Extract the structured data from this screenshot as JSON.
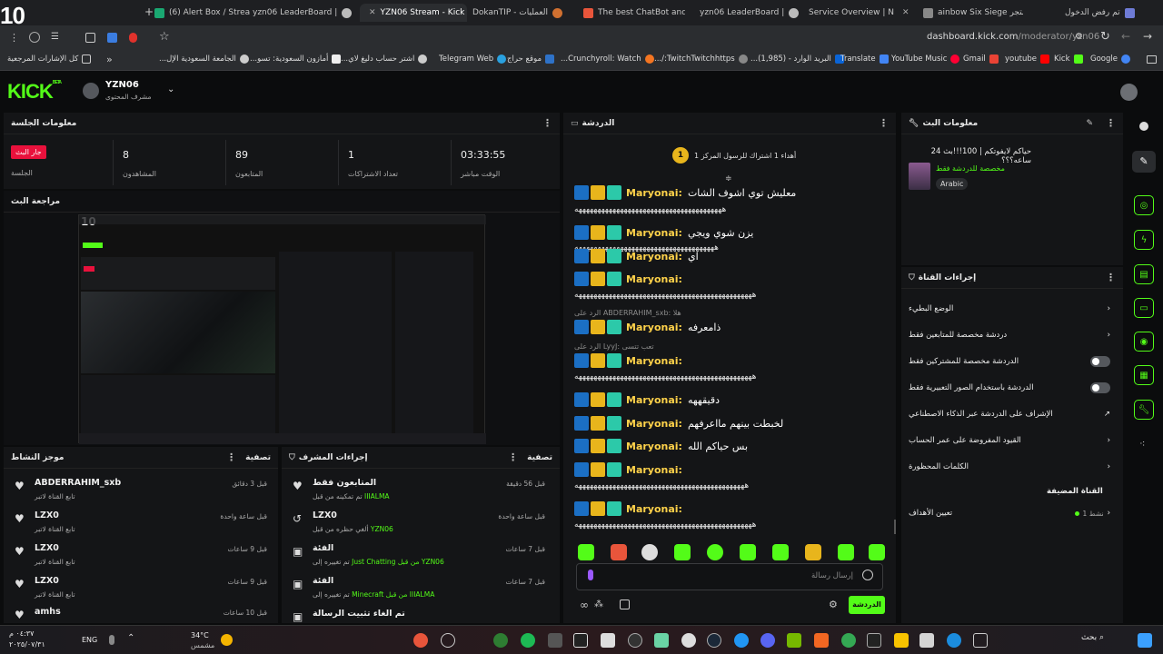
{
  "overlay_number": "10",
  "tabs": [
    {
      "title": "(6) Alert Box / Stream"
    },
    {
      "title": "yzn06 LeaderBoard |"
    },
    {
      "title": "YZN06 Stream - Kick",
      "active": true
    },
    {
      "title": "DokanTIP - العمليات"
    },
    {
      "title": "The best ChatBot and"
    },
    {
      "title": "yzn06 LeaderBoard |"
    },
    {
      "title": "Service Overview | N"
    },
    {
      "title": "ainbow Six Siege متجر"
    },
    {
      "title": "تم رفض الدخول"
    }
  ],
  "address": {
    "host": "dashboard.kick.com",
    "path": "/moderator/yzn06"
  },
  "bookmarks": [
    "كل الإشارات المرجعية",
    "الجامعة السعودية الإل...",
    "أمازون السعودية: تسو...",
    "اشتر حساب دليغ لاي...",
    "Telegram Web",
    "موقع حراج",
    "Crunchyroll: Watch...",
    "TwitchTwitchhttps:/...",
    "البريد الوارد - (1,985)...",
    "Translate",
    "YouTube Music",
    "Gmail",
    "youtube",
    "Kick",
    "Google"
  ],
  "header": {
    "logo": "KICK",
    "logo_sup": "BETA",
    "username": "YZN06",
    "role": "مشرف المحتوى"
  },
  "session": {
    "title": "معلومات الجلسة",
    "live_badge": "جار البث",
    "live_label": "الجلسة",
    "stats": [
      {
        "value": "8",
        "label": "المشاهدون"
      },
      {
        "value": "89",
        "label": "المتابعون"
      },
      {
        "value": "1",
        "label": "تعداد الاشتراكات"
      },
      {
        "value": "03:33:55",
        "label": "الوقت مباشر"
      }
    ]
  },
  "preview": {
    "title": "مراجعة البث",
    "thumb_number": "10"
  },
  "activity": {
    "title": "موجز النشاط",
    "filter": "تصفية",
    "items": [
      {
        "name": "ABDERRAHIM_sxb",
        "sub": "تابع القناة لاتبر",
        "time": "قبل 3 دقائق"
      },
      {
        "name": "LZX0",
        "sub": "تابع القناة لاتبر",
        "time": "قبل ساعة واحدة"
      },
      {
        "name": "LZX0",
        "sub": "تابع القناة لاتبر",
        "time": "قبل 9 ساعات"
      },
      {
        "name": "LZX0",
        "sub": "تابع القناة لاتبر",
        "time": "قبل 9 ساعات"
      },
      {
        "name": "amhs",
        "sub": "",
        "time": "قبل 10 ساعات"
      }
    ]
  },
  "modactions": {
    "title": "إجراءات المشرف",
    "filter": "تصفية",
    "items": [
      {
        "name": "المتابعون فقط",
        "sub": "تم تمكينه من قبل",
        "who": "IIIALMA",
        "time": "قبل 56 دقيقة"
      },
      {
        "name": "LZX0",
        "sub": "ألغي حظره من قبل",
        "who": "YZN06",
        "time": "قبل ساعة واحدة"
      },
      {
        "name": "الفئة",
        "sub": "تم تغييره إلى",
        "who": "Just Chatting",
        "who2": "من قبل YZN06",
        "time": "قبل 7 ساعات"
      },
      {
        "name": "الفئة",
        "sub": "تم تغييره إلى",
        "who": "Minecraft",
        "who2": "من قبل IIIALMA",
        "time": "قبل 7 ساعات"
      },
      {
        "name": "تم الغاء تثبيت الرسالة",
        "sub": "",
        "who": "",
        "time": ""
      }
    ]
  },
  "chat": {
    "title": "الدردشة",
    "gift_banner": "أهداء 1 اشتراك للرسول المركز 1",
    "gift_count": "1",
    "messages": [
      {
        "user": "Maryonai:",
        "text": "معليش توي اشوف الشات",
        "laugh": "هههههههههههههههههههههههههههههههههههههههه"
      },
      {
        "user": "Maryonai:",
        "text": "يزن شوي ويجي",
        "laugh": "هههههههههههههههههههههههههههههههههههههه"
      },
      {
        "user": "Maryonai:",
        "text": "اي",
        "laugh": ""
      },
      {
        "user": "Maryonai:",
        "text": "",
        "laugh": "هههههههههههههههههههههههههههههههههههههههههههههههه"
      },
      {
        "user": "Maryonai:",
        "text": "ذامعرفه",
        "laugh": "",
        "reply": "الرد على ABDERRAHIM_sxb: هلا"
      },
      {
        "user": "Maryonai:",
        "text": "",
        "laugh": "هههههههههههههههههههههههههههههههههههههههههههههههه",
        "reply": "الرد على LyyJ: تعب تتسى"
      },
      {
        "user": "Maryonai:",
        "text": "دقيقههه",
        "laugh": ""
      },
      {
        "user": "Maryonai:",
        "text": "لخبطت بينهم مااعرفهم",
        "laugh": ""
      },
      {
        "user": "Maryonai:",
        "text": "بس حياكم الله",
        "laugh": ""
      },
      {
        "user": "Maryonai:",
        "text": "",
        "laugh": "هههههههههههههههههههههههههههههههههههههههههههههه"
      },
      {
        "user": "Maryonai:",
        "text": "",
        "laugh": "هههههههههههههههههههههههههههههههههههههههههههههههه"
      }
    ],
    "input_placeholder": "إرسال رسالة",
    "send_label": "الدردشة"
  },
  "streaminfo": {
    "title": "معلومات البث",
    "stream_title": "حياكم لايفوتكم | 100!!!بث 24 ساعه؟؟؟",
    "category": "مخصصة للدردشة فقط",
    "language": "Arabic"
  },
  "channel_actions": {
    "title": "إجراءات القناة",
    "rows": [
      {
        "label": "الوضع البطيء",
        "control": "chevron"
      },
      {
        "label": "دردشة مخصصة للمتابعين فقط",
        "control": "chevron"
      },
      {
        "label": "الدردشة مخصصة للمشتركين فقط",
        "control": "toggle"
      },
      {
        "label": "الدردشة باستخدام الصور التعبيرية فقط",
        "control": "toggle"
      },
      {
        "label": "الإشراف على الدردشة عبر الذكاء الاصطناعي",
        "control": "link"
      },
      {
        "label": "القيود المفروضة على عمر الحساب",
        "control": "chevron"
      },
      {
        "label": "الكلمات المحظورة",
        "control": "chevron"
      }
    ],
    "featured_title": "القناة المضيفة",
    "goals_label": "تعيين الأهداف",
    "goals_value": "نشط 1"
  },
  "taskbar": {
    "weather_temp": "34°C",
    "weather_desc": "مشمس",
    "lang": "ENG",
    "time": "٠٤:٣٧ م",
    "date": "٢٠٢٥/٠٧/٣١",
    "search": "بحث"
  }
}
